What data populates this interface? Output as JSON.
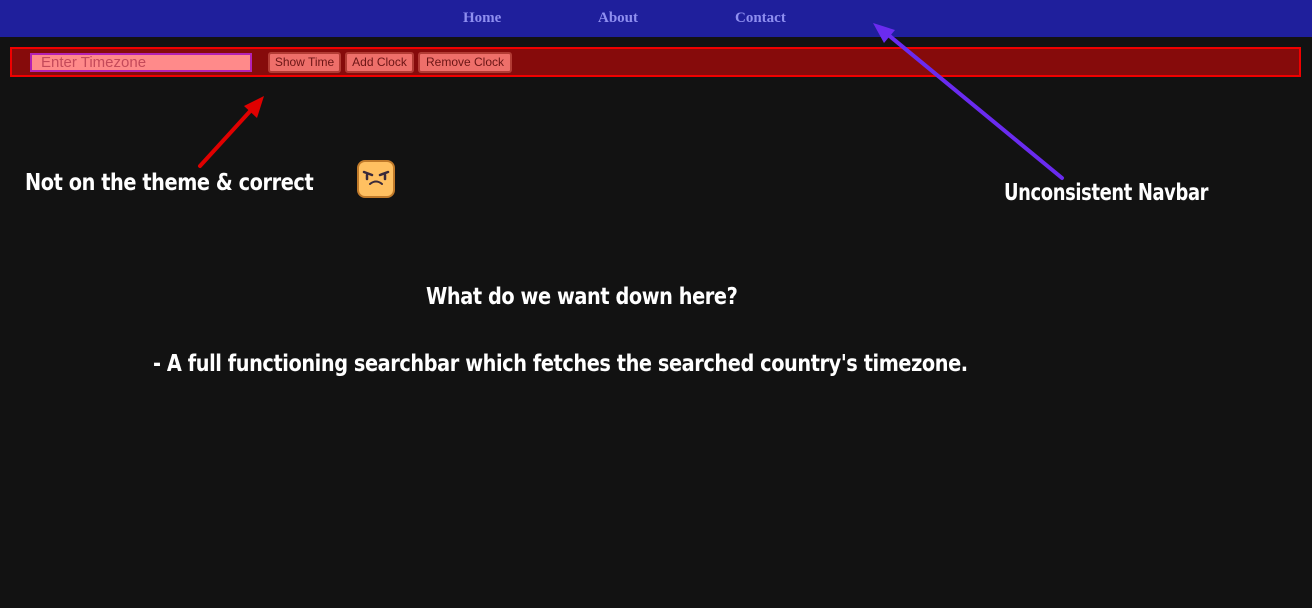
{
  "navbar": {
    "home": "Home",
    "about": "About",
    "contact": "Contact"
  },
  "toolbar": {
    "timezone_placeholder": "Enter Timezone",
    "timezone_value": "",
    "show_time": "Show Time",
    "add_clock": "Add Clock",
    "remove_clock": "Remove Clock"
  },
  "annotations": {
    "theme_note": "Not on the theme & correct",
    "navbar_note": "Unconsistent Navbar",
    "question": "What do we want down here?",
    "request": "- A full functioning searchbar which fetches the searched country's timezone.",
    "emoji_icon": "annoyed-face-icon"
  },
  "colors": {
    "background": "#121212",
    "navbar": "#1f1f9c",
    "nav_link": "#8f8ff0",
    "toolbar": "#860b0b",
    "toolbar_border": "#f00000",
    "red_arrow": "#e00000",
    "purple_arrow": "#6a2bf0"
  }
}
